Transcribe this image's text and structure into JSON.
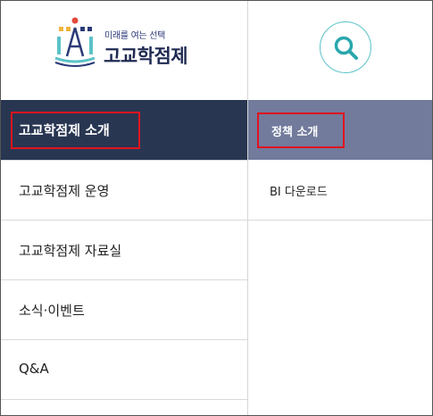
{
  "logo": {
    "tagline": "미래를 여는 선택",
    "name": "고교학점제"
  },
  "search": {
    "icon": "search-icon",
    "accent": "#5bc2c7"
  },
  "menu": {
    "items": [
      {
        "label": "고교학점제 소개"
      },
      {
        "label": "고교학점제 운영"
      },
      {
        "label": "고교학점제 자료실"
      },
      {
        "label": "소식·이벤트"
      },
      {
        "label": "Q&A"
      }
    ]
  },
  "submenu": {
    "items": [
      {
        "label": "정책 소개"
      },
      {
        "label": "BI 다운로드"
      }
    ]
  },
  "colors": {
    "active_main_bg": "#293652",
    "active_sub_bg": "#727b9c",
    "highlight": "#e0141e"
  }
}
